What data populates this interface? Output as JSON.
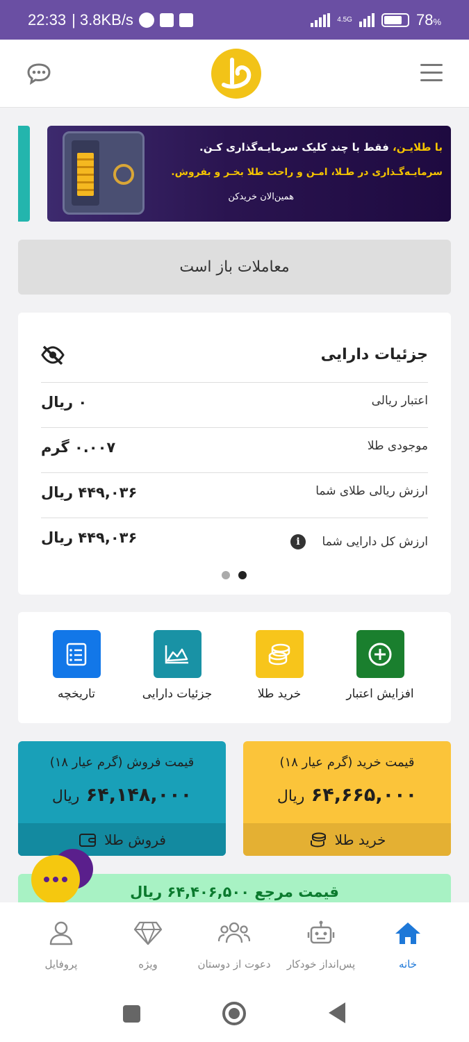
{
  "status_bar": {
    "time": "22:33",
    "net_speed": "| 3.8KB/s",
    "network": "4.5G",
    "battery": "78",
    "battery_unit": "%",
    "battery_level": 0.78
  },
  "header": {
    "chat_icon": "chat-bubble-icon",
    "logo": "talayin-logo",
    "menu_icon": "hamburger-menu-icon"
  },
  "banner": {
    "highlight": "با طلایـن،",
    "line1": " فقط با چند کلیک سرمایـه‌گذاری کـن.",
    "line2": "سرمایـه‌گـذاری در طـلا، امـن و راحت طلا بخـر و بفروش.",
    "line3": "همین‌الان خریدکن"
  },
  "market_status": "معاملات باز است",
  "assets": {
    "title": "جزئیات دارایی",
    "rows": [
      {
        "label": "اعتبار ریالی",
        "value": "۰ ریال"
      },
      {
        "label": "موجودی طلا",
        "value": "۰.۰۰۷ گرم"
      },
      {
        "label": "ارزش ریالی طلای شما",
        "value": "۴۴۹,۰۳۶ ریال"
      },
      {
        "label": "ارزش کل دارایی شما",
        "value": "۴۴۹,۰۳۶ ریال"
      }
    ],
    "info_glyph": "i"
  },
  "actions": [
    {
      "label": "افزایش اعتبار",
      "icon": "plus-circle-icon",
      "color": "#1a7f2e"
    },
    {
      "label": "خرید طلا",
      "icon": "coins-icon",
      "color": "#f7c51b"
    },
    {
      "label": "جزئیات دارایی",
      "icon": "chart-icon",
      "color": "#1992a5"
    },
    {
      "label": "تاریخچه",
      "icon": "checklist-icon",
      "color": "#1277e8"
    }
  ],
  "prices": {
    "buy": {
      "title": "قیمت خرید (گرم عیار ۱۸)",
      "value": "۶۴,۶۶۵,۰۰۰",
      "unit": "ریال",
      "button": "خرید طلا"
    },
    "sell": {
      "title": "قیمت فروش (گرم عیار ۱۸)",
      "value": "۶۴,۱۴۸,۰۰۰",
      "unit": "ریال",
      "button": "فروش طلا"
    }
  },
  "reference_price": {
    "label": "قیمت مرجع",
    "value": "۶۴,۴۰۶,۵۰۰",
    "unit": "ریال"
  },
  "bottom_nav": [
    {
      "label": "خانه",
      "icon": "home-icon",
      "active": true
    },
    {
      "label": "پس‌انداز خودکار",
      "icon": "robot-icon",
      "active": false
    },
    {
      "label": "دعوت از دوستان",
      "icon": "users-icon",
      "active": false
    },
    {
      "label": "ویژه",
      "icon": "diamond-icon",
      "active": false
    },
    {
      "label": "پروفایل",
      "icon": "profile-icon",
      "active": false
    }
  ],
  "colors": {
    "status_bar": "#6a4fa3",
    "brand_yellow": "#f2c318",
    "sell_card": "#19a0b8",
    "buy_card": "#fbc43a",
    "reference_bg": "#a8f2c4",
    "active_nav": "#1e78d8"
  }
}
